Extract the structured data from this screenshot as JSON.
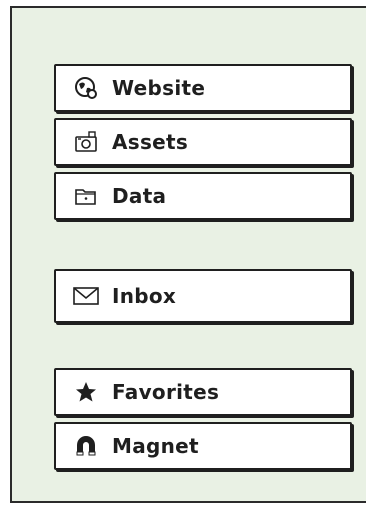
{
  "menu": {
    "group1": [
      {
        "label": "Website",
        "icon": "globe-icon"
      },
      {
        "label": "Assets",
        "icon": "camera-icon"
      },
      {
        "label": "Data",
        "icon": "folder-icon"
      }
    ],
    "group2": [
      {
        "label": "Inbox",
        "icon": "envelope-icon"
      }
    ],
    "group3": [
      {
        "label": "Favorites",
        "icon": "star-icon"
      },
      {
        "label": "Magnet",
        "icon": "magnet-icon"
      }
    ]
  },
  "colors": {
    "panel_background": "#e9f1e4",
    "item_background": "#ffffff",
    "ink": "#1f1f1f"
  }
}
